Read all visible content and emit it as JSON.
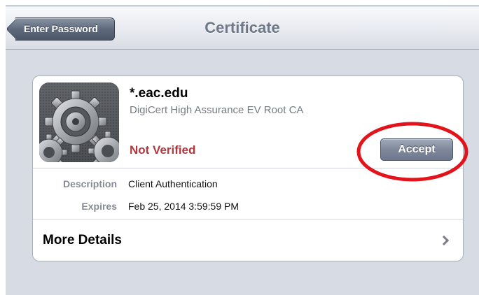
{
  "navbar": {
    "title": "Certificate",
    "back_label": "Enter Password"
  },
  "certificate": {
    "icon": "gears-icon",
    "name": "*.eac.edu",
    "issuer": "DigiCert High Assurance EV Root CA",
    "status": "Not Verified",
    "accept_label": "Accept"
  },
  "details": [
    {
      "label": "Description",
      "value": "Client Authentication"
    },
    {
      "label": "Expires",
      "value": "Feb 25, 2014 3:59:59 PM"
    }
  ],
  "more_details": {
    "label": "More Details",
    "icon": "chevron-right-icon"
  },
  "colors": {
    "status_red": "#b3383d",
    "annotation_red": "#e3131b",
    "background": "#d7dbe3"
  }
}
